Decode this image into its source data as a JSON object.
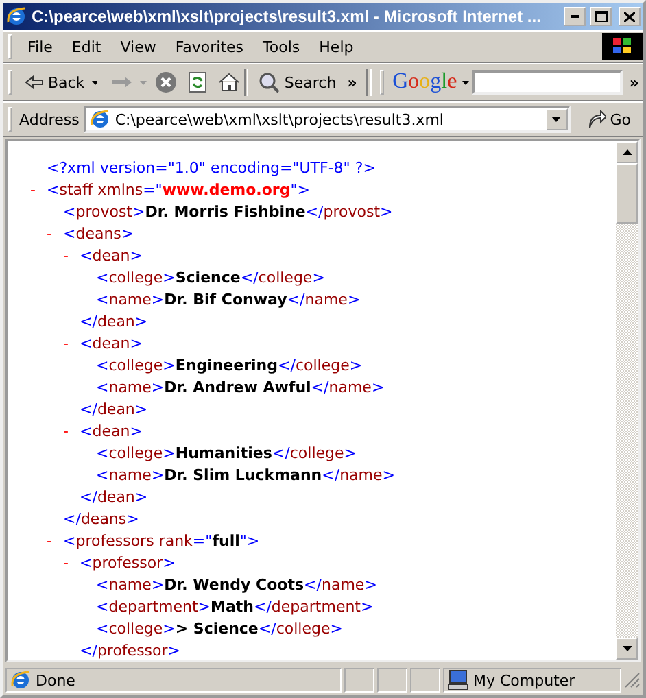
{
  "window": {
    "title": "C:\\pearce\\web\\xml\\xslt\\projects\\result3.xml - Microsoft Internet ..."
  },
  "menu": [
    {
      "label": "File"
    },
    {
      "label": "Edit"
    },
    {
      "label": "View"
    },
    {
      "label": "Favorites"
    },
    {
      "label": "Tools"
    },
    {
      "label": "Help"
    }
  ],
  "toolbar": {
    "back": "Back",
    "search": "Search",
    "more": "»",
    "google": "Google",
    "google_more": "»"
  },
  "address_bar": {
    "label": "Address",
    "url": "C:\\pearce\\web\\xml\\xslt\\projects\\result3.xml",
    "go": "Go"
  },
  "xml": [
    {
      "parts": [
        {
          "kind": "mark",
          "text": "<?xml version=\"1.0\" encoding=\"UTF-8\" ?>"
        }
      ]
    },
    {
      "toggle": "-",
      "parts": [
        {
          "kind": "mark",
          "text": "<"
        },
        {
          "kind": "tag",
          "text": "staff"
        },
        {
          "kind": "tag",
          "text": " xmlns"
        },
        {
          "kind": "mark",
          "text": "=\""
        },
        {
          "kind": "nsvalue",
          "text": "www.demo.org"
        },
        {
          "kind": "mark",
          "text": "\">"
        }
      ],
      "children": [
        {
          "parts": [
            {
              "kind": "mark",
              "text": "<"
            },
            {
              "kind": "tag",
              "text": "provost"
            },
            {
              "kind": "mark",
              "text": ">"
            },
            {
              "kind": "text",
              "text": "Dr. Morris Fishbine"
            },
            {
              "kind": "mark",
              "text": "</"
            },
            {
              "kind": "tag",
              "text": "provost"
            },
            {
              "kind": "mark",
              "text": ">"
            }
          ]
        },
        {
          "toggle": "-",
          "parts": [
            {
              "kind": "mark",
              "text": "<"
            },
            {
              "kind": "tag",
              "text": "deans"
            },
            {
              "kind": "mark",
              "text": ">"
            }
          ],
          "children": [
            {
              "toggle": "-",
              "parts": [
                {
                  "kind": "mark",
                  "text": "<"
                },
                {
                  "kind": "tag",
                  "text": "dean"
                },
                {
                  "kind": "mark",
                  "text": ">"
                }
              ],
              "children": [
                {
                  "parts": [
                    {
                      "kind": "mark",
                      "text": "<"
                    },
                    {
                      "kind": "tag",
                      "text": "college"
                    },
                    {
                      "kind": "mark",
                      "text": ">"
                    },
                    {
                      "kind": "text",
                      "text": "Science"
                    },
                    {
                      "kind": "mark",
                      "text": "</"
                    },
                    {
                      "kind": "tag",
                      "text": "college"
                    },
                    {
                      "kind": "mark",
                      "text": ">"
                    }
                  ]
                },
                {
                  "parts": [
                    {
                      "kind": "mark",
                      "text": "<"
                    },
                    {
                      "kind": "tag",
                      "text": "name"
                    },
                    {
                      "kind": "mark",
                      "text": ">"
                    },
                    {
                      "kind": "text",
                      "text": "Dr. Bif Conway"
                    },
                    {
                      "kind": "mark",
                      "text": "</"
                    },
                    {
                      "kind": "tag",
                      "text": "name"
                    },
                    {
                      "kind": "mark",
                      "text": ">"
                    }
                  ]
                }
              ],
              "close": [
                {
                  "kind": "mark",
                  "text": "</"
                },
                {
                  "kind": "tag",
                  "text": "dean"
                },
                {
                  "kind": "mark",
                  "text": ">"
                }
              ]
            },
            {
              "toggle": "-",
              "parts": [
                {
                  "kind": "mark",
                  "text": "<"
                },
                {
                  "kind": "tag",
                  "text": "dean"
                },
                {
                  "kind": "mark",
                  "text": ">"
                }
              ],
              "children": [
                {
                  "parts": [
                    {
                      "kind": "mark",
                      "text": "<"
                    },
                    {
                      "kind": "tag",
                      "text": "college"
                    },
                    {
                      "kind": "mark",
                      "text": ">"
                    },
                    {
                      "kind": "text",
                      "text": "Engineering"
                    },
                    {
                      "kind": "mark",
                      "text": "</"
                    },
                    {
                      "kind": "tag",
                      "text": "college"
                    },
                    {
                      "kind": "mark",
                      "text": ">"
                    }
                  ]
                },
                {
                  "parts": [
                    {
                      "kind": "mark",
                      "text": "<"
                    },
                    {
                      "kind": "tag",
                      "text": "name"
                    },
                    {
                      "kind": "mark",
                      "text": ">"
                    },
                    {
                      "kind": "text",
                      "text": "Dr. Andrew Awful"
                    },
                    {
                      "kind": "mark",
                      "text": "</"
                    },
                    {
                      "kind": "tag",
                      "text": "name"
                    },
                    {
                      "kind": "mark",
                      "text": ">"
                    }
                  ]
                }
              ],
              "close": [
                {
                  "kind": "mark",
                  "text": "</"
                },
                {
                  "kind": "tag",
                  "text": "dean"
                },
                {
                  "kind": "mark",
                  "text": ">"
                }
              ]
            },
            {
              "toggle": "-",
              "parts": [
                {
                  "kind": "mark",
                  "text": "<"
                },
                {
                  "kind": "tag",
                  "text": "dean"
                },
                {
                  "kind": "mark",
                  "text": ">"
                }
              ],
              "children": [
                {
                  "parts": [
                    {
                      "kind": "mark",
                      "text": "<"
                    },
                    {
                      "kind": "tag",
                      "text": "college"
                    },
                    {
                      "kind": "mark",
                      "text": ">"
                    },
                    {
                      "kind": "text",
                      "text": "Humanities"
                    },
                    {
                      "kind": "mark",
                      "text": "</"
                    },
                    {
                      "kind": "tag",
                      "text": "college"
                    },
                    {
                      "kind": "mark",
                      "text": ">"
                    }
                  ]
                },
                {
                  "parts": [
                    {
                      "kind": "mark",
                      "text": "<"
                    },
                    {
                      "kind": "tag",
                      "text": "name"
                    },
                    {
                      "kind": "mark",
                      "text": ">"
                    },
                    {
                      "kind": "text",
                      "text": "Dr. Slim Luckmann"
                    },
                    {
                      "kind": "mark",
                      "text": "</"
                    },
                    {
                      "kind": "tag",
                      "text": "name"
                    },
                    {
                      "kind": "mark",
                      "text": ">"
                    }
                  ]
                }
              ],
              "close": [
                {
                  "kind": "mark",
                  "text": "</"
                },
                {
                  "kind": "tag",
                  "text": "dean"
                },
                {
                  "kind": "mark",
                  "text": ">"
                }
              ]
            }
          ],
          "close": [
            {
              "kind": "mark",
              "text": "</"
            },
            {
              "kind": "tag",
              "text": "deans"
            },
            {
              "kind": "mark",
              "text": ">"
            }
          ]
        },
        {
          "toggle": "-",
          "parts": [
            {
              "kind": "mark",
              "text": "<"
            },
            {
              "kind": "tag",
              "text": "professors"
            },
            {
              "kind": "tag",
              "text": " rank"
            },
            {
              "kind": "mark",
              "text": "=\""
            },
            {
              "kind": "value",
              "text": "full"
            },
            {
              "kind": "mark",
              "text": "\">"
            }
          ],
          "children": [
            {
              "toggle": "-",
              "parts": [
                {
                  "kind": "mark",
                  "text": "<"
                },
                {
                  "kind": "tag",
                  "text": "professor"
                },
                {
                  "kind": "mark",
                  "text": ">"
                }
              ],
              "children": [
                {
                  "parts": [
                    {
                      "kind": "mark",
                      "text": "<"
                    },
                    {
                      "kind": "tag",
                      "text": "name"
                    },
                    {
                      "kind": "mark",
                      "text": ">"
                    },
                    {
                      "kind": "text",
                      "text": "Dr. Wendy Coots"
                    },
                    {
                      "kind": "mark",
                      "text": "</"
                    },
                    {
                      "kind": "tag",
                      "text": "name"
                    },
                    {
                      "kind": "mark",
                      "text": ">"
                    }
                  ]
                },
                {
                  "parts": [
                    {
                      "kind": "mark",
                      "text": "<"
                    },
                    {
                      "kind": "tag",
                      "text": "department"
                    },
                    {
                      "kind": "mark",
                      "text": ">"
                    },
                    {
                      "kind": "text",
                      "text": "Math"
                    },
                    {
                      "kind": "mark",
                      "text": "</"
                    },
                    {
                      "kind": "tag",
                      "text": "department"
                    },
                    {
                      "kind": "mark",
                      "text": ">"
                    }
                  ]
                },
                {
                  "parts": [
                    {
                      "kind": "mark",
                      "text": "<"
                    },
                    {
                      "kind": "tag",
                      "text": "college"
                    },
                    {
                      "kind": "mark",
                      "text": ">"
                    },
                    {
                      "kind": "text",
                      "text": "> Science"
                    },
                    {
                      "kind": "mark",
                      "text": "</"
                    },
                    {
                      "kind": "tag",
                      "text": "college"
                    },
                    {
                      "kind": "mark",
                      "text": ">"
                    }
                  ]
                }
              ],
              "close": [
                {
                  "kind": "mark",
                  "text": "</"
                },
                {
                  "kind": "tag",
                  "text": "professor"
                },
                {
                  "kind": "mark",
                  "text": ">"
                }
              ]
            }
          ]
        }
      ]
    }
  ],
  "status_bar": {
    "status": "Done",
    "zone": "My Computer"
  }
}
